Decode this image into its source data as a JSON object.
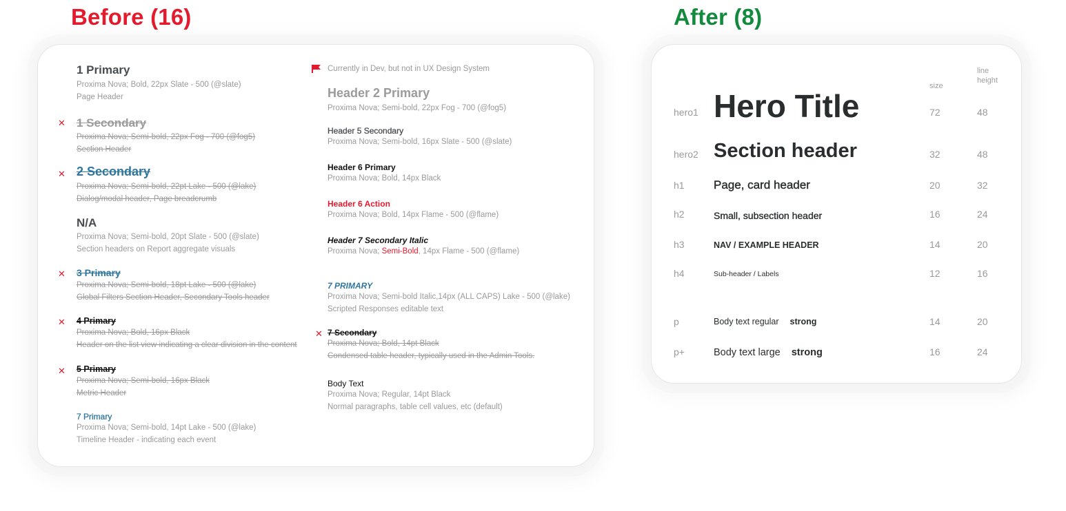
{
  "before": {
    "title": "Before (16)",
    "title_color": "#e31b2d",
    "legend": {
      "icon": "flag-icon",
      "text": "Currently in Dev, but not in UX Design System"
    },
    "left_column": [
      {
        "name": "1 Primary",
        "spec": "Proxima Nova; Bold, 22px  Slate - 500 (@slate)",
        "usage": "Page Header",
        "removed": false
      },
      {
        "name": "1 Secondary",
        "spec": "Proxima Nova; Semi-bold, 22px  Fog - 700 (@fog5)",
        "usage": "Section Header",
        "removed": true
      },
      {
        "name": "2 Secondary",
        "spec": "Proxima Nova; Semi-bold, 22pt  Lake - 500 (@lake)",
        "usage": "Dialog/modal header, Page breadcrumb",
        "removed": true
      },
      {
        "name": "N/A",
        "spec": "Proxima Nova; Semi-bold, 20pt  Slate - 500 (@slate)",
        "usage": "Section headers on Report aggregate visuals",
        "removed": false
      },
      {
        "name": "3 Primary",
        "spec": "Proxima Nova; Semi-bold, 18pt  Lake - 500 (@lake)",
        "usage": "Global Filters Section Header, Secondary Tools header",
        "removed": true
      },
      {
        "name": "4 Primary",
        "spec": "Proxima Nova; Bold, 16px  Black",
        "usage": "Header on the list view indicating a clear division in the content",
        "removed": true
      },
      {
        "name": "5 Primary",
        "spec": "Proxima Nova; Semi-bold, 16px  Black",
        "usage": "Metric Header",
        "removed": true
      },
      {
        "name": "7 Primary",
        "spec": "Proxima Nova; Semi-bold, 14pt  Lake - 500 (@lake)",
        "usage": "Timeline Header - indicating each event",
        "removed": false
      }
    ],
    "right_column": [
      {
        "name": "Header 2 Primary",
        "spec": "Proxima Nova; Semi-bold, 22px  Fog - 700 (@fog5)",
        "removed": false
      },
      {
        "name": "Header 5 Secondary",
        "spec": "Proxima Nova; Semi-bold, 16px  Slate - 500 (@slate)",
        "removed": false
      },
      {
        "name": "Header 6 Primary",
        "spec": "Proxima Nova; Bold, 14px  Black",
        "removed": false
      },
      {
        "name": "Header 6 Action",
        "spec": "Proxima Nova; Bold, 14px  Flame - 500 (@flame)",
        "removed": false
      },
      {
        "name": "Header 7 Secondary Italic",
        "spec_prefix": "Proxima Nova; ",
        "spec_highlight": "Semi-Bold",
        "spec_suffix": ", 14px  Flame - 500 (@flame)",
        "removed": false
      },
      {
        "name": "7 PRIMARY",
        "spec": "Proxima Nova; Semi-bold Italic,14px (ALL CAPS)  Lake - 500 (@lake)",
        "usage": "Scripted Responses editable text",
        "removed": false
      },
      {
        "name": "7 Secondary",
        "spec": "Proxima Nova; Bold, 14pt  Black",
        "usage": "Condensed table header, typically used in the Admin Tools.",
        "removed": true
      },
      {
        "name": "Body Text",
        "spec": "Proxima Nova; Regular, 14pt  Black",
        "usage": "Normal paragraphs, table cell values, etc (default)",
        "removed": false
      }
    ],
    "removed_icon": "x-mark-icon"
  },
  "after": {
    "title": "After (8)",
    "title_color": "#138a3e",
    "columns": {
      "size": "size",
      "line_height_1": "line",
      "line_height_2": "height"
    },
    "rows": [
      {
        "code": "hero1",
        "sample": "Hero Title",
        "size": "72",
        "line_height": "48"
      },
      {
        "code": "hero2",
        "sample": "Section header",
        "size": "32",
        "line_height": "48"
      },
      {
        "code": "h1",
        "sample": "Page, card header",
        "size": "20",
        "line_height": "32"
      },
      {
        "code": "h2",
        "sample": "Small, subsection header",
        "size": "16",
        "line_height": "24"
      },
      {
        "code": "h3",
        "sample": "NAV / EXAMPLE HEADER",
        "size": "14",
        "line_height": "20"
      },
      {
        "code": "h4",
        "sample": "Sub-header / Labels",
        "size": "12",
        "line_height": "16"
      },
      {
        "code": "p",
        "sample": "Body text regular",
        "strong": "strong",
        "size": "14",
        "line_height": "20"
      },
      {
        "code": "p+",
        "sample": "Body text large",
        "strong": "strong",
        "size": "16",
        "line_height": "24"
      }
    ]
  }
}
